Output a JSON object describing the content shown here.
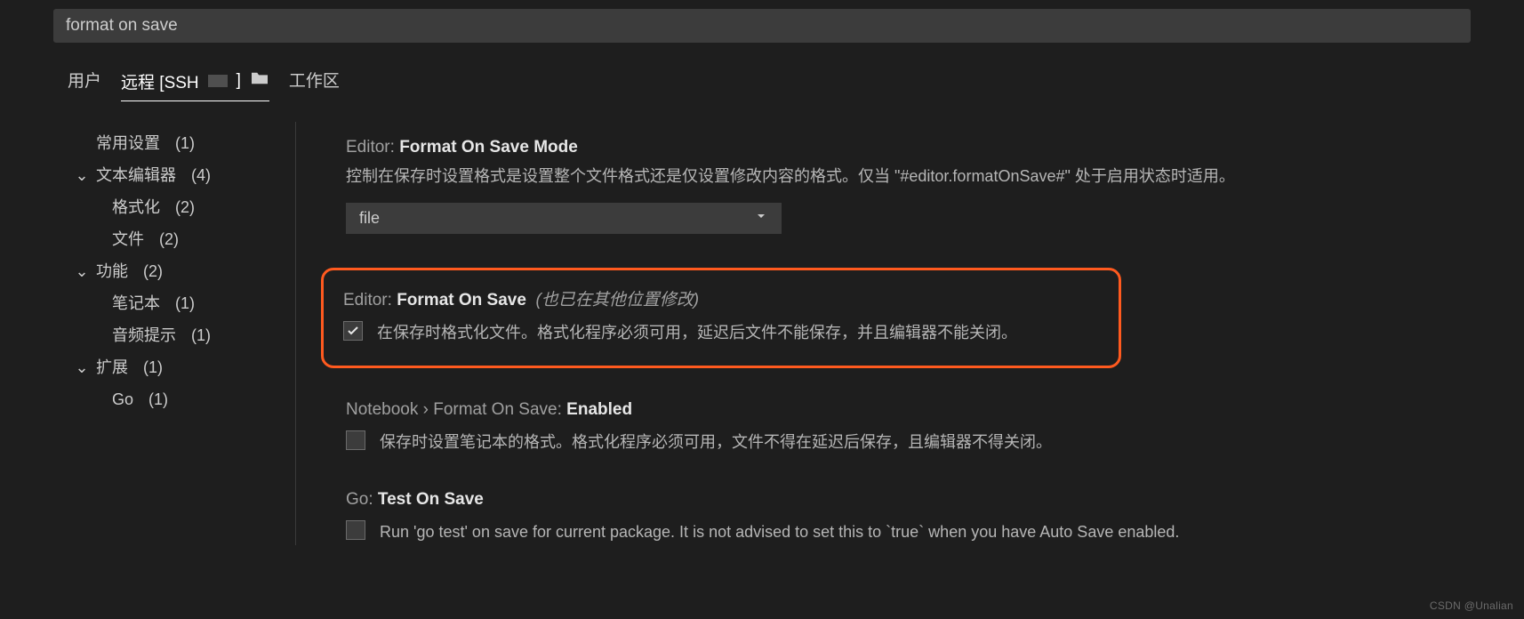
{
  "search": {
    "value": "format on save"
  },
  "tabs": {
    "user": "用户",
    "remote_prefix": "远程 [SSH",
    "workspace": "工作区"
  },
  "toc": {
    "common": {
      "label": "常用设置",
      "count": "(1)"
    },
    "text_editor": {
      "label": "文本编辑器",
      "count": "(4)"
    },
    "formatting": {
      "label": "格式化",
      "count": "(2)"
    },
    "files": {
      "label": "文件",
      "count": "(2)"
    },
    "features": {
      "label": "功能",
      "count": "(2)"
    },
    "notebook": {
      "label": "笔记本",
      "count": "(1)"
    },
    "audio": {
      "label": "音频提示",
      "count": "(1)"
    },
    "extensions": {
      "label": "扩展",
      "count": "(1)"
    },
    "go": {
      "label": "Go",
      "count": "(1)"
    }
  },
  "settings": {
    "formatOnSaveMode": {
      "scope": "Editor: ",
      "title": "Format On Save Mode",
      "desc": "控制在保存时设置格式是设置整个文件格式还是仅设置修改内容的格式。仅当 \"#editor.formatOnSave#\" 处于启用状态时适用。",
      "value": "file"
    },
    "formatOnSave": {
      "scope": "Editor: ",
      "title": "Format On Save",
      "hint": "(也已在其他位置修改)",
      "desc": "在保存时格式化文件。格式化程序必须可用，延迟后文件不能保存，并且编辑器不能关闭。",
      "checked": true
    },
    "notebookFormatOnSave": {
      "scope": "Notebook › Format On Save: ",
      "title": "Enabled",
      "desc": "保存时设置笔记本的格式。格式化程序必须可用，文件不得在延迟后保存，且编辑器不得关闭。",
      "checked": false
    },
    "goTestOnSave": {
      "scope": "Go: ",
      "title": "Test On Save",
      "desc": "Run 'go test' on save for current package. It is not advised to set this to `true` when you have Auto Save enabled.",
      "checked": false
    }
  },
  "watermark": "CSDN @Unalian"
}
